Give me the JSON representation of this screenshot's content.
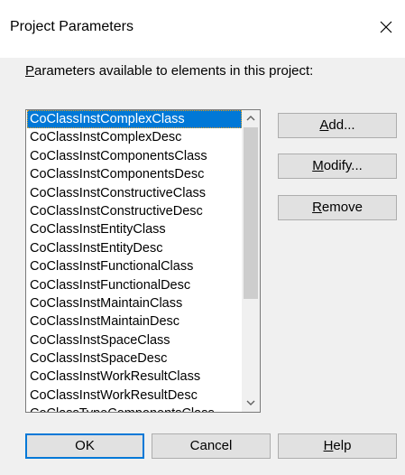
{
  "dialog": {
    "title": "Project Parameters",
    "prompt_first": "P",
    "prompt_rest": "arameters available to elements in this project:"
  },
  "icons": {
    "close": "close-icon",
    "scroll_up": "chevron-up-icon",
    "scroll_down": "chevron-down-icon"
  },
  "parameters": {
    "selected": "CoClassInstComplexClass",
    "items": [
      "CoClassInstComplexClass",
      "CoClassInstComplexDesc",
      "CoClassInstComponentsClass",
      "CoClassInstComponentsDesc",
      "CoClassInstConstructiveClass",
      "CoClassInstConstructiveDesc",
      "CoClassInstEntityClass",
      "CoClassInstEntityDesc",
      "CoClassInstFunctionalClass",
      "CoClassInstFunctionalDesc",
      "CoClassInstMaintainClass",
      "CoClassInstMaintainDesc",
      "CoClassInstSpaceClass",
      "CoClassInstSpaceDesc",
      "CoClassInstWorkResultClass",
      "CoClassInstWorkResultDesc",
      "CoClassTypeComponentsClass"
    ]
  },
  "side_buttons": {
    "add_mnemonic": "A",
    "add_rest": "dd...",
    "modify_mnemonic": "M",
    "modify_rest": "odify...",
    "remove_mnemonic": "R",
    "remove_rest": "emove"
  },
  "footer": {
    "ok": "OK",
    "cancel": "Cancel",
    "help_mnemonic": "H",
    "help_rest": "elp"
  },
  "colors": {
    "selection": "#0078d7",
    "dialog_bg": "#f0f0f0",
    "button_bg": "#e1e1e1"
  }
}
